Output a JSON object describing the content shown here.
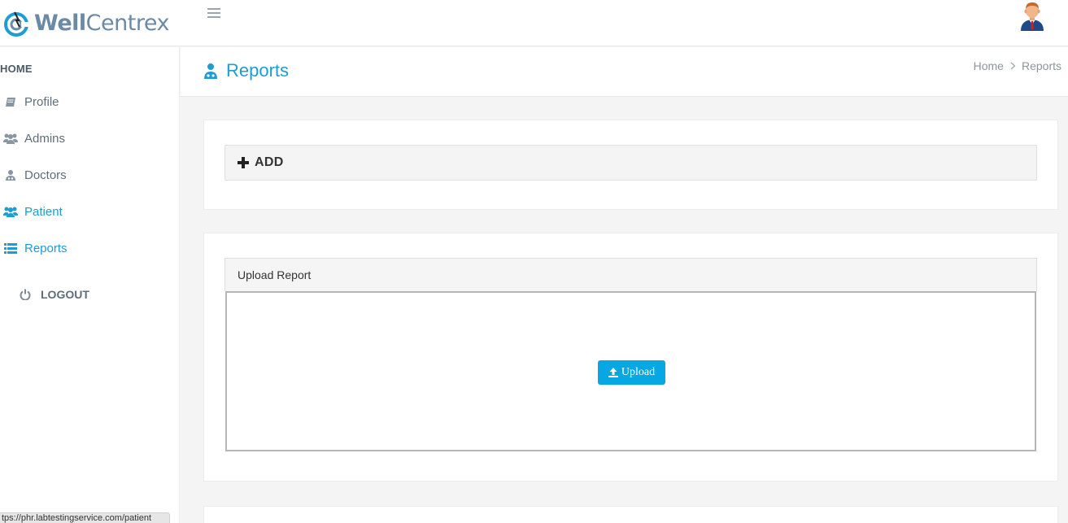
{
  "app": {
    "logo_bold": "Well",
    "logo_rest": "Centrex"
  },
  "sidebar": {
    "home_label": "HOME",
    "items": [
      {
        "label": "Profile",
        "icon": "book-icon"
      },
      {
        "label": "Admins",
        "icon": "users-icon"
      },
      {
        "label": "Doctors",
        "icon": "user-md-icon"
      },
      {
        "label": "Patient",
        "icon": "users-icon"
      },
      {
        "label": "Reports",
        "icon": "list-icon"
      }
    ],
    "logout_label": "LOGOUT"
  },
  "header": {
    "title": "Reports",
    "breadcrumb": [
      "Home",
      "Reports"
    ]
  },
  "add_section": {
    "label": "ADD"
  },
  "upload_section": {
    "title": "Upload Report",
    "button_label": "Upload"
  },
  "status_bar": {
    "url": "tps://phr.labtestingservice.com/patient"
  },
  "colors": {
    "accent": "#1e9cd3",
    "button": "#06a7e2",
    "logo": "#6b8aa6"
  }
}
